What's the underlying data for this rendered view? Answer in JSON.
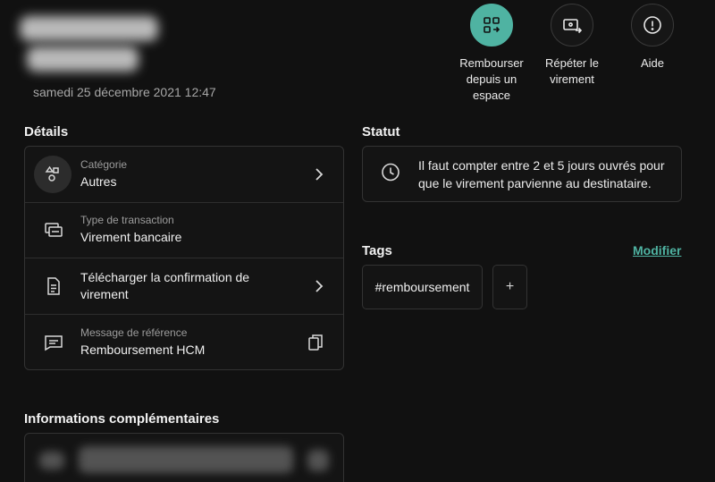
{
  "header": {
    "date": "samedi 25 décembre 2021 12:47",
    "actions": [
      {
        "label": "Rembourser depuis un espace"
      },
      {
        "label": "Répéter le virement"
      },
      {
        "label": "Aide"
      }
    ]
  },
  "details": {
    "title": "Détails",
    "rows": [
      {
        "label": "Catégorie",
        "value": "Autres"
      },
      {
        "label": "Type de transaction",
        "value": "Virement bancaire"
      },
      {
        "value": "Télécharger la confirmation de virement"
      },
      {
        "label": "Message de référence",
        "value": "Remboursement HCM"
      }
    ]
  },
  "statut": {
    "title": "Statut",
    "text": "Il faut compter entre 2 et 5 jours ouvrés pour que le virement parvienne au destinataire."
  },
  "tags": {
    "title": "Tags",
    "modify_label": "Modifier",
    "items": [
      "#remboursement"
    ],
    "add_label": "+"
  },
  "more": {
    "title": "Informations complémentaires"
  },
  "colors": {
    "accent": "#4fb3a2",
    "background": "#111111"
  }
}
